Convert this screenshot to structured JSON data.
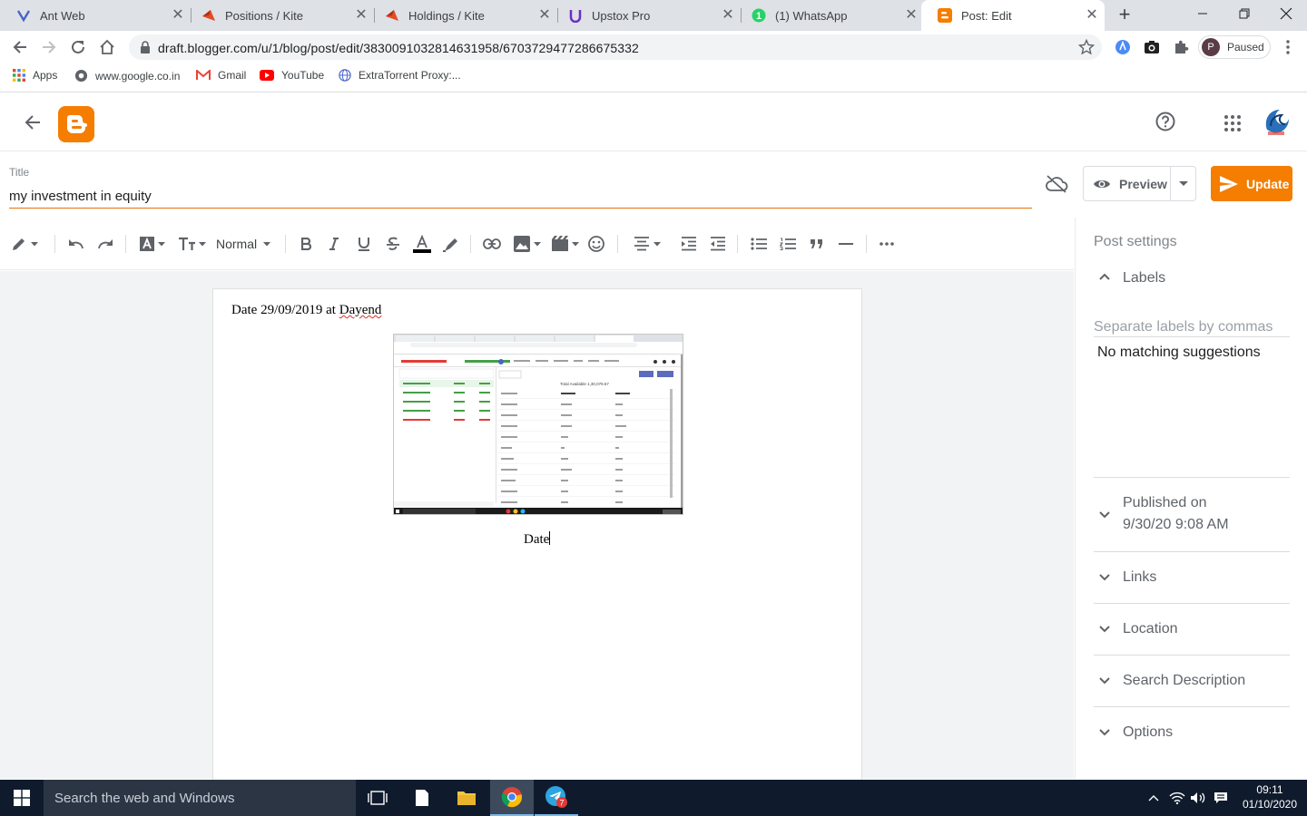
{
  "tabs": [
    {
      "title": "Ant Web",
      "icon": "antweb-icon",
      "active": false
    },
    {
      "title": "Positions / Kite",
      "icon": "kite-icon",
      "active": false
    },
    {
      "title": "Holdings / Kite",
      "icon": "kite-icon",
      "active": false
    },
    {
      "title": "Upstox Pro",
      "icon": "upstox-icon",
      "active": false
    },
    {
      "title": "(1) WhatsApp",
      "icon": "whatsapp-icon",
      "active": false
    },
    {
      "title": "Post: Edit",
      "icon": "blogger-icon",
      "active": true
    }
  ],
  "browser": {
    "url": "draft.blogger.com/u/1/blog/post/edit/3830091032814631958/6703729477286675332",
    "profile_initial": "P",
    "profile_status": "Paused"
  },
  "bookmarks": [
    {
      "label": "Apps",
      "icon": "apps-grid-icon"
    },
    {
      "label": "www.google.co.in",
      "icon": "globe-icon"
    },
    {
      "label": "Gmail",
      "icon": "gmail-icon"
    },
    {
      "label": "YouTube",
      "icon": "youtube-icon"
    },
    {
      "label": "ExtraTorrent Proxy:...",
      "icon": "globe-icon"
    }
  ],
  "editor": {
    "title_label": "Title",
    "title_value": "my investment in equity",
    "preview_label": "Preview",
    "update_label": "Update",
    "paragraph_style": "Normal",
    "body_line_prefix": "Date 29/09/2019 at ",
    "body_line_word": "Dayend",
    "caption": "Date"
  },
  "embedded_screenshot": {
    "total_label": "Total Available 1,30,078.67"
  },
  "post_settings": {
    "heading": "Post settings",
    "labels_section": "Labels",
    "labels_placeholder": "Separate labels by commas",
    "labels_suggestion": "No matching suggestions",
    "published_label": "Published on",
    "published_date": "9/30/20 9:08 AM",
    "sections": [
      "Links",
      "Location",
      "Search Description",
      "Options"
    ]
  },
  "taskbar": {
    "search_placeholder": "Search the web and Windows",
    "time": "09:11",
    "date": "01/10/2020",
    "telegram_badge": "7"
  },
  "colors": {
    "accent": "#f57d00",
    "title_underline": "#e8710a",
    "tabstrip": "#dee1e6",
    "taskbar": "#0f1b2d"
  }
}
